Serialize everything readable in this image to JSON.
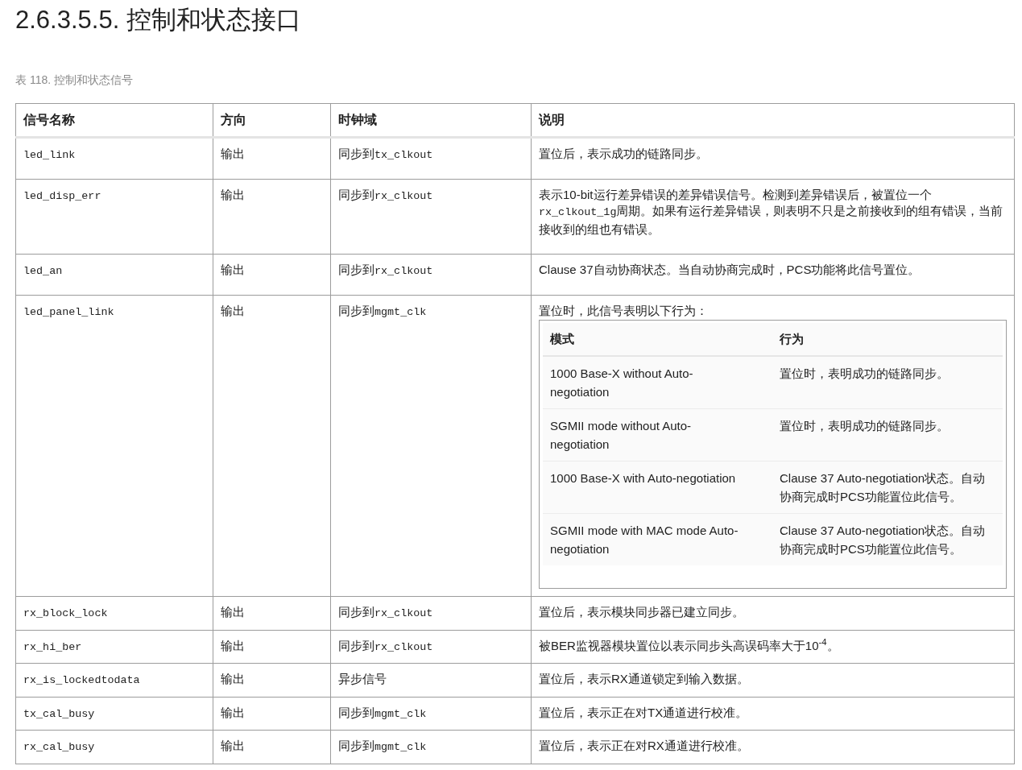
{
  "heading": "2.6.3.5.5. 控制和状态接口",
  "caption": "表 118. 控制和状态信号",
  "table": {
    "columns": [
      "信号名称",
      "方向",
      "时钟域",
      "说明"
    ],
    "rows": [
      {
        "signal": "led_link",
        "direction": "输出",
        "clock": [
          {
            "kind": "text",
            "text": "同步到"
          },
          {
            "kind": "code",
            "text": "tx_clkout"
          }
        ],
        "description": [
          {
            "kind": "text",
            "text": "置位后，表示成功的链路同步。"
          }
        ]
      },
      {
        "signal": "led_disp_err",
        "direction": "输出",
        "clock": [
          {
            "kind": "text",
            "text": "同步到"
          },
          {
            "kind": "code",
            "text": "rx_clkout"
          }
        ],
        "description": [
          {
            "kind": "text",
            "text": "表示10-bit运行差异错误的差异错误信号。检测到差异错误后，被置位一个"
          },
          {
            "kind": "code",
            "text": "rx_clkout_1g"
          },
          {
            "kind": "text",
            "text": "周期。如果有运行差异错误，则表明不只是之前接收到的组有错误，当前接收到的组也有错误。"
          }
        ]
      },
      {
        "signal": "led_an",
        "direction": "输出",
        "clock": [
          {
            "kind": "text",
            "text": "同步到"
          },
          {
            "kind": "code",
            "text": "rx_clkout"
          }
        ],
        "description": [
          {
            "kind": "text",
            "text": "Clause 37自动协商状态。当自动协商完成时，PCS功能将此信号置位。"
          }
        ]
      },
      {
        "signal": "led_panel_link",
        "direction": "输出",
        "clock": [
          {
            "kind": "text",
            "text": "同步到"
          },
          {
            "kind": "code",
            "text": "mgmt_clk"
          }
        ],
        "description": [
          {
            "kind": "text",
            "text": "置位时，此信号表明以下行为："
          }
        ],
        "modes_table": {
          "columns": [
            "模式",
            "行为"
          ],
          "rows": [
            [
              "1000 Base-X without Auto-negotiation",
              "置位时，表明成功的链路同步。"
            ],
            [
              "SGMII mode without Auto-negotiation",
              "置位时，表明成功的链路同步。"
            ],
            [
              "1000 Base-X with Auto-negotiation",
              "Clause 37 Auto-negotiation状态。自动协商完成时PCS功能置位此信号。"
            ],
            [
              "SGMII mode with MAC mode Auto-negotiation",
              "Clause 37 Auto-negotiation状态。自动协商完成时PCS功能置位此信号。"
            ]
          ]
        }
      },
      {
        "signal": "rx_block_lock",
        "direction": "输出",
        "clock": [
          {
            "kind": "text",
            "text": "同步到"
          },
          {
            "kind": "code",
            "text": "rx_clkout"
          }
        ],
        "description": [
          {
            "kind": "text",
            "text": "置位后，表示模块同步器已建立同步。"
          }
        ]
      },
      {
        "signal": "rx_hi_ber",
        "direction": "输出",
        "clock": [
          {
            "kind": "text",
            "text": "同步到"
          },
          {
            "kind": "code",
            "text": "rx_clkout"
          }
        ],
        "description": [
          {
            "kind": "text",
            "text": "被BER监视器模块置位以表示同步头高误码率大于10$^{-4}$。"
          }
        ]
      },
      {
        "signal": "rx_is_lockedtodata",
        "direction": "输出",
        "clock": [
          {
            "kind": "text",
            "text": "异步信号"
          }
        ],
        "description": [
          {
            "kind": "text",
            "text": "置位后，表示RX通道锁定到输入数据。"
          }
        ]
      },
      {
        "signal": "tx_cal_busy",
        "direction": "输出",
        "clock": [
          {
            "kind": "text",
            "text": "同步到"
          },
          {
            "kind": "code",
            "text": "mgmt_clk"
          }
        ],
        "description": [
          {
            "kind": "text",
            "text": "置位后，表示正在对TX通道进行校准。"
          }
        ]
      },
      {
        "signal": "rx_cal_busy",
        "direction": "输出",
        "clock": [
          {
            "kind": "text",
            "text": "同步到"
          },
          {
            "kind": "code",
            "text": "mgmt_clk"
          }
        ],
        "description": [
          {
            "kind": "text",
            "text": "置位后，表示正在对RX通道进行校准。"
          }
        ]
      }
    ]
  }
}
